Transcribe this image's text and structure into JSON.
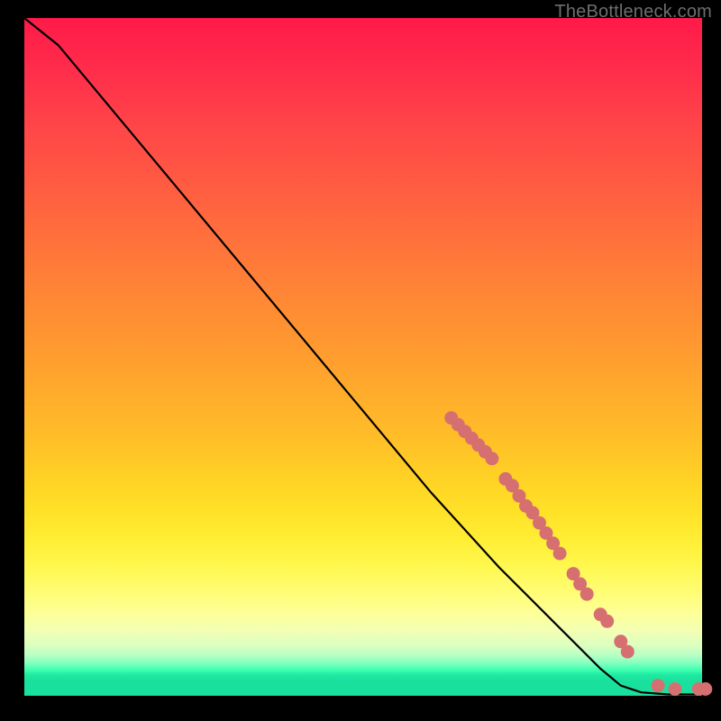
{
  "watermark": "TheBottleneck.com",
  "colors": {
    "background": "#000000",
    "line": "#000000",
    "marker": "#d67070",
    "watermark": "#6e6e6e"
  },
  "chart_data": {
    "type": "line",
    "title": "",
    "xlabel": "",
    "ylabel": "",
    "xlim": [
      0,
      100
    ],
    "ylim": [
      0,
      100
    ],
    "grid": false,
    "legend": false,
    "curve": [
      {
        "x": 0,
        "y": 100
      },
      {
        "x": 5,
        "y": 96
      },
      {
        "x": 10,
        "y": 90
      },
      {
        "x": 20,
        "y": 78
      },
      {
        "x": 30,
        "y": 66
      },
      {
        "x": 40,
        "y": 54
      },
      {
        "x": 50,
        "y": 42
      },
      {
        "x": 60,
        "y": 30
      },
      {
        "x": 70,
        "y": 19
      },
      {
        "x": 80,
        "y": 9
      },
      {
        "x": 85,
        "y": 4
      },
      {
        "x": 88,
        "y": 1.5
      },
      {
        "x": 91,
        "y": 0.5
      },
      {
        "x": 95,
        "y": 0.2
      },
      {
        "x": 100,
        "y": 0.2
      }
    ],
    "markers": [
      {
        "x": 63,
        "y": 41
      },
      {
        "x": 64,
        "y": 40
      },
      {
        "x": 65,
        "y": 39
      },
      {
        "x": 66,
        "y": 38
      },
      {
        "x": 67,
        "y": 37
      },
      {
        "x": 68,
        "y": 36
      },
      {
        "x": 69,
        "y": 35
      },
      {
        "x": 71,
        "y": 32
      },
      {
        "x": 72,
        "y": 31
      },
      {
        "x": 73,
        "y": 29.5
      },
      {
        "x": 74,
        "y": 28
      },
      {
        "x": 75,
        "y": 27
      },
      {
        "x": 76,
        "y": 25.5
      },
      {
        "x": 77,
        "y": 24
      },
      {
        "x": 78,
        "y": 22.5
      },
      {
        "x": 79,
        "y": 21
      },
      {
        "x": 81,
        "y": 18
      },
      {
        "x": 82,
        "y": 16.5
      },
      {
        "x": 83,
        "y": 15
      },
      {
        "x": 85,
        "y": 12
      },
      {
        "x": 86,
        "y": 11
      },
      {
        "x": 88,
        "y": 8
      },
      {
        "x": 89,
        "y": 6.5
      },
      {
        "x": 93.5,
        "y": 1.5
      },
      {
        "x": 96,
        "y": 1.0
      },
      {
        "x": 99.5,
        "y": 1.0
      },
      {
        "x": 100.5,
        "y": 1.0
      }
    ]
  }
}
